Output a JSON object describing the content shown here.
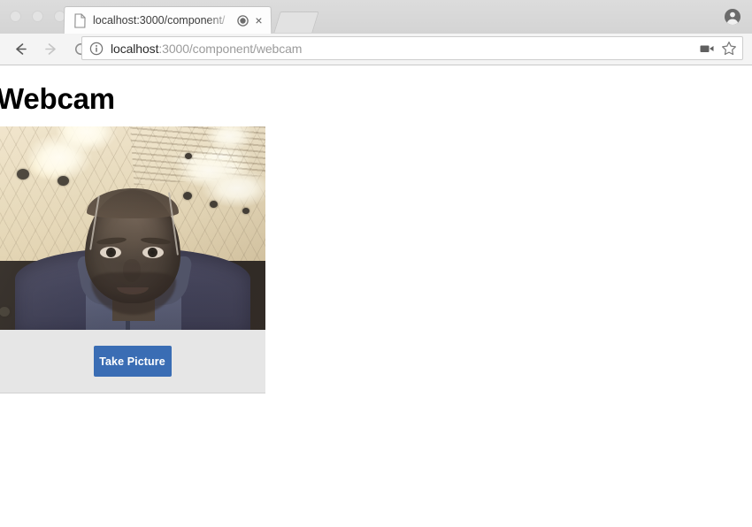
{
  "browser": {
    "window_controls": [
      "close",
      "minimize",
      "maximize"
    ],
    "tab": {
      "title": "localhost:3000/component/",
      "favicon": "document-icon",
      "recording_indicator": "media-recording-icon",
      "close_label": "×"
    },
    "new_tab_label": "",
    "profile_icon": "account-circle-icon",
    "toolbar": {
      "back_icon": "arrow-left-icon",
      "forward_icon": "arrow-right-icon",
      "reload_icon": "reload-icon",
      "site_info_icon": "info-circle-icon",
      "camera_icon": "video-camera-icon",
      "bookmark_icon": "star-outline-icon"
    },
    "omnibox": {
      "url_host": "localhost",
      "url_path": ":3000/component/webcam",
      "url_full": "localhost:3000/component/webcam"
    }
  },
  "page": {
    "title": "Webcam",
    "webcam": {
      "stream_label": "live-webcam-preview",
      "button_label": "Take Picture"
    }
  },
  "colors": {
    "accent_button": "#3a6db4",
    "footer_bg": "#e6e6e6",
    "chrome_tabstrip": "#d6d6d6",
    "toolbar_bg": "#f4f4f4",
    "page_bg": "#ffffff",
    "heading_text": "#000000"
  }
}
